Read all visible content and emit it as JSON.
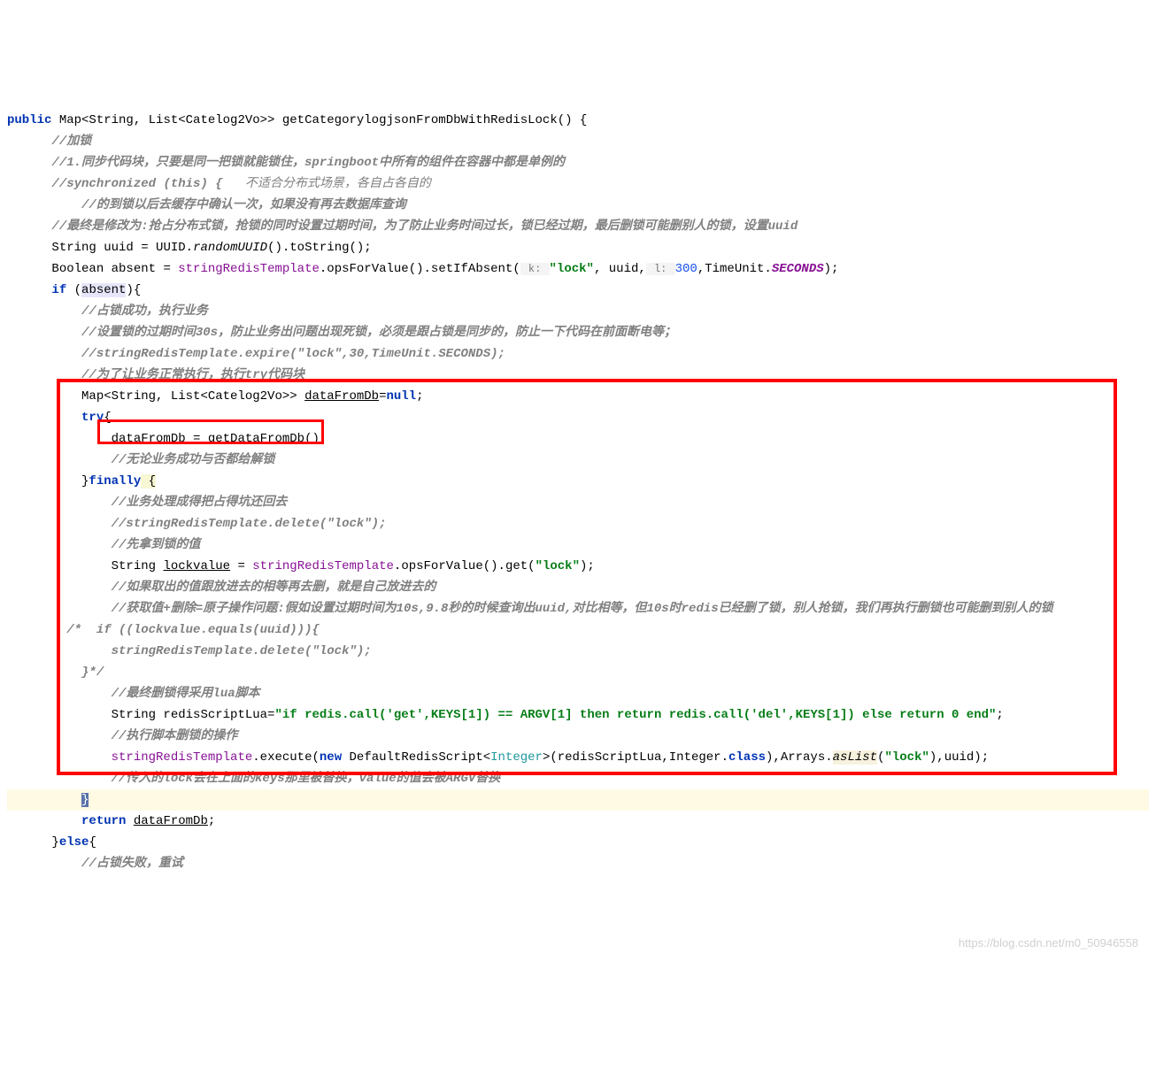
{
  "code": {
    "l1_public": "public",
    "l1_sig": " Map<String, List<Catelog2Vo>> getCategorylogjsonFromDbWithRedisLock() {",
    "l2": "//加锁",
    "l3": "//1.同步代码块，只要是同一把锁就能锁住，springboot中所有的组件在容器中都是单例的",
    "l4a": "//synchronized (this) {",
    "l4b": "   不适合分布式场景，各自占各自的",
    "l5": "//的到锁以后去缓存中确认一次，如果没有再去数据库查询",
    "l6": "//最终是修改为:抢占分布式锁，抢锁的同时设置过期时间，为了防止业务时间过长，锁已经过期，最后删锁可能删别人的锁，设置uuid",
    "l7a": "String uuid = UUID.",
    "l7b": "randomUUID",
    "l7c": "().toString();",
    "l8a": "Boolean absent = ",
    "l8b": "stringRedisTemplate",
    "l8c": ".opsForValue().setIfAbsent(",
    "l8h1": " k: ",
    "l8s1": "\"lock\"",
    "l8d": ", uuid,",
    "l8h2": " l: ",
    "l8n": "300",
    "l8e": ",TimeUnit.",
    "l8f": "SECONDS",
    "l8g": ");",
    "l9a": "if",
    "l9b": " (",
    "l9c": "absent",
    "l9d": "){",
    "l10": "//占锁成功，执行业务",
    "l11": "//设置锁的过期时间30s，防止业务出问题出现死锁，必须是跟占锁是同步的，防止一下代码在前面断电等；",
    "l12": "//stringRedisTemplate.expire(\"lock\",30,TimeUnit.SECONDS);",
    "l13": "//为了让业务正常执行，执行try代码块",
    "l14a": "Map<String, List<Catelog2Vo>> ",
    "l14b": "dataFromDb",
    "l14c": "=",
    "l14d": "null",
    "l14e": ";",
    "l15a": "try",
    "l15b": "{",
    "l16a": "dataFromDb = ",
    "l16b": "getDataFromDb",
    "l16c": "();",
    "l17": "//无论业务成功与否都给解锁",
    "l18a": "}",
    "l18b": "finally",
    "l18c": " {",
    "l19": "//业务处理成得把占得坑还回去",
    "l20": "//stringRedisTemplate.delete(\"lock\");",
    "l21": "//先拿到锁的值",
    "l22a": "String ",
    "l22b": "lockvalue",
    "l22c": " = ",
    "l22d": "stringRedisTemplate",
    "l22e": ".opsForValue().get(",
    "l22f": "\"lock\"",
    "l22g": ");",
    "l23": "//如果取出的值跟放进去的相等再去删，就是自己放进去的",
    "l24": "//获取值+删除=原子操作问题:假如设置过期时间为10s,9.8秒的时候查询出uuid,对比相等，但10s时redis已经删了锁，别人抢锁，我们再执行删锁也可能删到别人的锁",
    "l25": "/*  if ((lockvalue.equals(uuid))){",
    "l26": "       stringRedisTemplate.delete(\"lock\");",
    "l27": "   }*/",
    "l28": "//最终删锁得采用lua脚本",
    "l29a": "String redisScriptLua=",
    "l29b": "\"if redis.call('get',KEYS[1]) == ARGV[1] then return redis.call('del',KEYS[1]) else return 0 end\"",
    "l29c": ";",
    "l30": "//执行脚本删锁的操作",
    "l31a": "stringRedisTemplate",
    "l31b": ".execute(",
    "l31c": "new",
    "l31d": " DefaultRedisScript<",
    "l31e": "Integer",
    "l31f": ">(redisScriptLua,Integer.",
    "l31g": "class",
    "l31h": "),Arrays.",
    "l31i": "asList",
    "l31j": "(",
    "l31k": "\"lock\"",
    "l31l": "),uuid);",
    "l32": "//传入的lock会在上面的keys那里被替换，value的值会被ARGV替换",
    "l33": "}",
    "l34a": "return",
    "l34b": " ",
    "l34c": "dataFromDb",
    "l34d": ";",
    "l35a": "}",
    "l35b": "else",
    "l35c": "{",
    "l36": "//占锁失败，重试"
  },
  "watermark": "https://blog.csdn.net/m0_50946558"
}
